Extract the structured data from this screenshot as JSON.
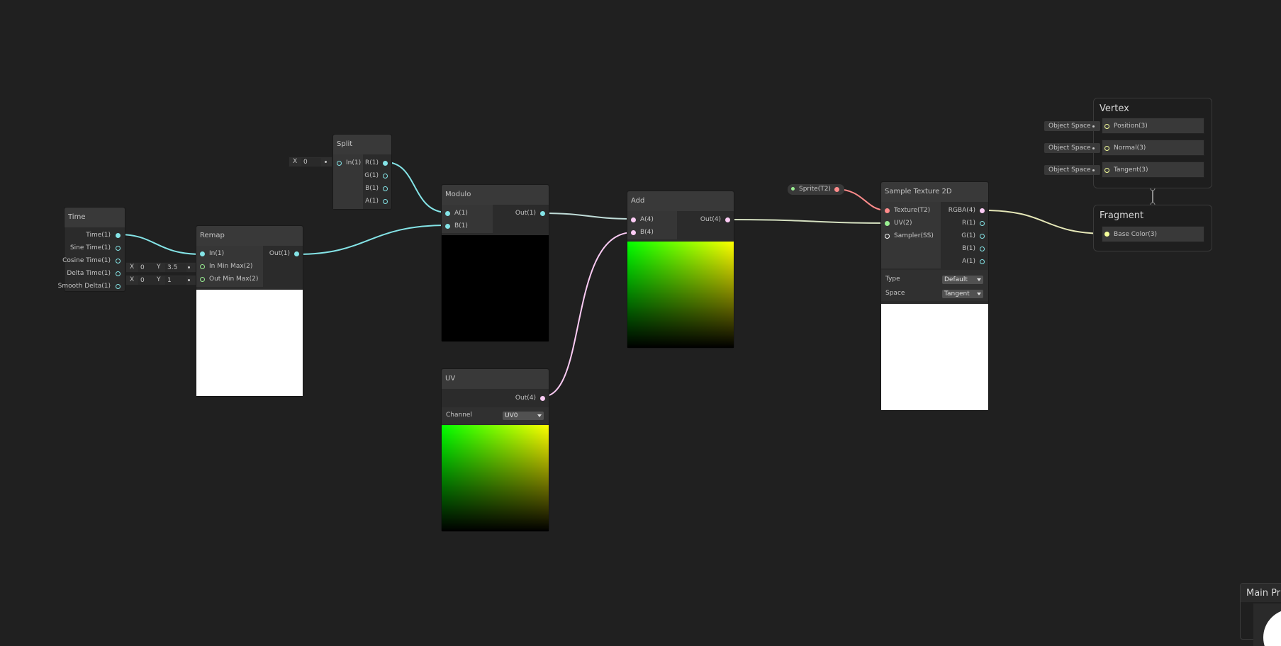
{
  "time_node": {
    "title": "Time",
    "outputs": [
      "Time(1)",
      "Sine Time(1)",
      "Cosine Time(1)",
      "Delta Time(1)",
      "Smooth Delta(1)"
    ]
  },
  "remap_node": {
    "title": "Remap",
    "inputs": [
      "In(1)",
      "In Min Max(2)",
      "Out Min Max(2)"
    ],
    "output": "Out(1)",
    "in_min_max": {
      "x_label": "X",
      "x": "0",
      "y_label": "Y",
      "y": "3.5"
    },
    "out_min_max": {
      "x_label": "X",
      "x": "0",
      "y_label": "Y",
      "y": "1"
    }
  },
  "split_node": {
    "title": "Split",
    "input": "In(1)",
    "outputs": [
      "R(1)",
      "G(1)",
      "B(1)",
      "A(1)"
    ],
    "in_field": {
      "x_label": "X",
      "x": "0"
    }
  },
  "modulo_node": {
    "title": "Modulo",
    "inputs": [
      "A(1)",
      "B(1)"
    ],
    "output": "Out(1)"
  },
  "uv_node": {
    "title": "UV",
    "output": "Out(4)",
    "channel_label": "Channel",
    "channel_value": "UV0"
  },
  "add_node": {
    "title": "Add",
    "inputs": [
      "A(4)",
      "B(4)"
    ],
    "output": "Out(4)"
  },
  "sprite_property": {
    "label": "Sprite(T2)"
  },
  "sample_texture_node": {
    "title": "Sample Texture 2D",
    "inputs": [
      "Texture(T2)",
      "UV(2)",
      "Sampler(SS)"
    ],
    "outputs": [
      "RGBA(4)",
      "R(1)",
      "G(1)",
      "B(1)",
      "A(1)"
    ],
    "type_label": "Type",
    "type_value": "Default",
    "space_label": "Space",
    "space_value": "Tangent"
  },
  "vertex_context": {
    "title": "Vertex",
    "blocks": [
      "Position(3)",
      "Normal(3)",
      "Tangent(3)"
    ],
    "space_label": "Object Space"
  },
  "fragment_context": {
    "title": "Fragment",
    "blocks": [
      "Base Color(3)"
    ]
  },
  "main_preview": {
    "title": "Main Pr"
  },
  "colors": {
    "float": "#84e4e7",
    "vector2": "#9aef92",
    "vector3": "#f6ff9a",
    "vector4": "#fbcbf4",
    "texture": "#ff8b8b",
    "background": "#202020"
  }
}
